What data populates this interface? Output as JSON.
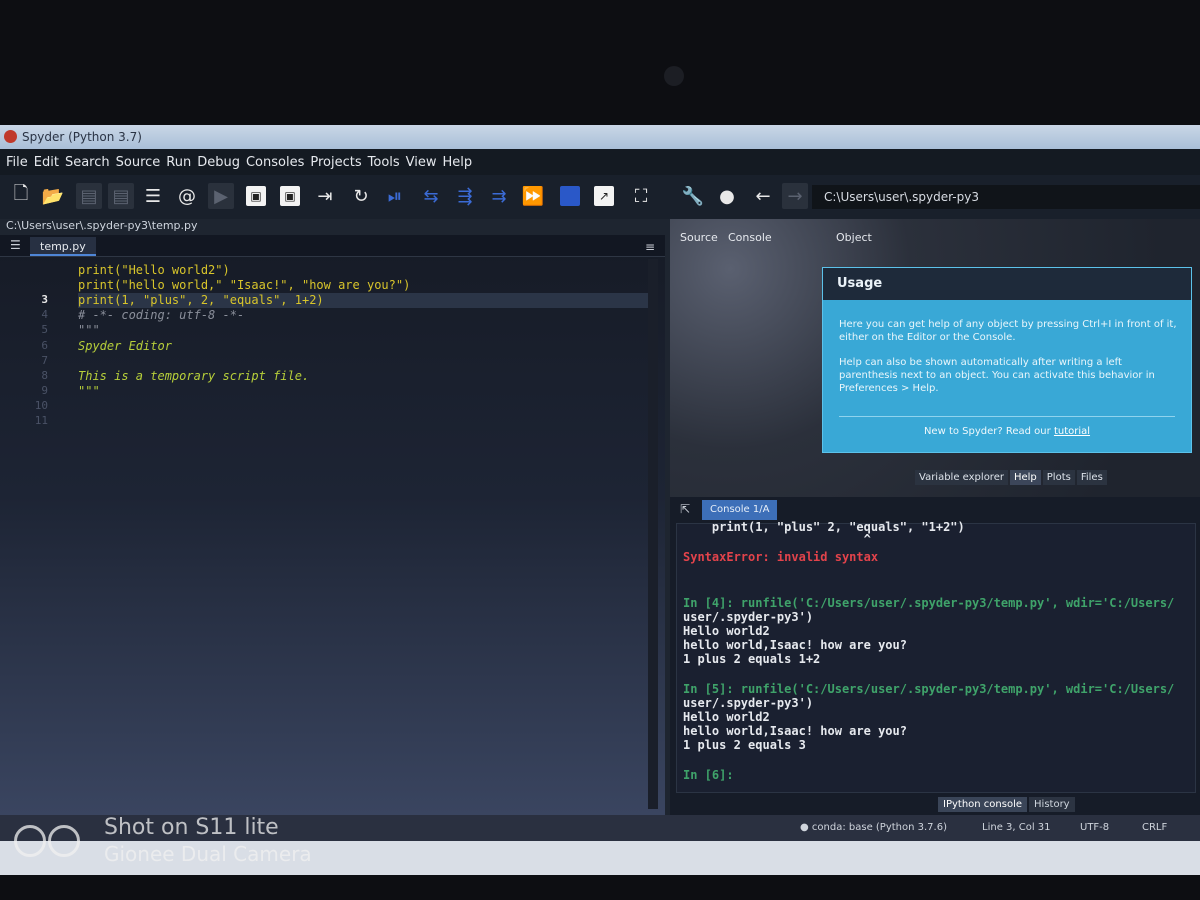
{
  "window": {
    "title": "Spyder (Python 3.7)"
  },
  "menu": [
    "File",
    "Edit",
    "Search",
    "Source",
    "Run",
    "Debug",
    "Consoles",
    "Projects",
    "Tools",
    "View",
    "Help"
  ],
  "toolbar": {
    "path": "C:\\Users\\user\\.spyder-py3"
  },
  "editor": {
    "file_path": "C:\\Users\\user\\.spyder-py3\\temp.py",
    "tab": "temp.py",
    "line_numbers": [
      "",
      "",
      "3",
      "4",
      "5",
      "6",
      "7",
      "8",
      "9",
      "10",
      "11"
    ],
    "lines": [
      "print(\"Hello world2\")",
      "print(\"hello world,\" \"Isaac!\", \"how are you?\")",
      "print(1, \"plus\", 2, \"equals\", 1+2)",
      "# -*- coding: utf-8 -*-",
      "\"\"\"",
      "Spyder Editor",
      "",
      "This is a temporary script file.",
      "\"\"\""
    ]
  },
  "help": {
    "source_label": "Source",
    "source_value": "Console",
    "object_label": "Object",
    "usage_title": "Usage",
    "usage_p1": "Here you can get help of any object by pressing Ctrl+I in front of it, either on the Editor or the Console.",
    "usage_p2": "Help can also be shown automatically after writing a left parenthesis next to an object. You can activate this behavior in Preferences > Help.",
    "usage_new": "New to Spyder? Read our",
    "usage_link": "tutorial",
    "tabs": [
      "Variable explorer",
      "Help",
      "Plots",
      "Files"
    ]
  },
  "console": {
    "tab": "Console 1/A",
    "lines": [
      "    print(1, \"plus\" 2, \"equals\", \"1+2\")",
      "                         ^",
      "SyntaxError: invalid syntax",
      "",
      "",
      "In [4]: runfile('C:/Users/user/.spyder-py3/temp.py', wdir='C:/Users/",
      "user/.spyder-py3')",
      "Hello world2",
      "hello world,Isaac! how are you?",
      "1 plus 2 equals 1+2",
      "",
      "In [5]: runfile('C:/Users/user/.spyder-py3/temp.py', wdir='C:/Users/",
      "user/.spyder-py3')",
      "Hello world2",
      "hello world,Isaac! how are you?",
      "1 plus 2 equals 3",
      "",
      "In [6]:"
    ],
    "bottom_tabs": [
      "IPython console",
      "History"
    ]
  },
  "status": {
    "env": "conda: base (Python 3.7.6)",
    "position": "Line 3, Col 31",
    "encoding": "UTF-8",
    "eol": "CRLF"
  },
  "watermark": {
    "line1": "Shot on S11 lite",
    "line2": "Gionee Dual Camera"
  }
}
